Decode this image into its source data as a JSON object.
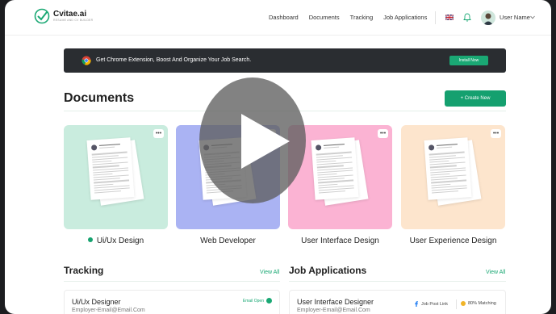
{
  "brand": {
    "name": "Cvitae.ai",
    "tagline": "RESUME AND CV BUILDER",
    "accent": "#1aa874"
  },
  "nav": {
    "items": [
      "Dashboard",
      "Documents",
      "Tracking",
      "Job Applications"
    ]
  },
  "user": {
    "name": "User Name"
  },
  "banner": {
    "text": "Get Chrome Extension, Boost And Organize Your Job Search.",
    "button": "Install Now"
  },
  "documents": {
    "title": "Documents",
    "create_button": "+ Create New",
    "menu_glyph": "•••",
    "cards": [
      {
        "label": "Ui/Ux Design",
        "bg": "#c9ecde",
        "active": true
      },
      {
        "label": "Web Developer",
        "bg": "#aab3f3",
        "active": false
      },
      {
        "label": "User Interface Design",
        "bg": "#fbb3d3",
        "active": false
      },
      {
        "label": "User Experience Design",
        "bg": "#fde5cd",
        "active": false
      }
    ]
  },
  "tracking": {
    "title": "Tracking",
    "view_all": "View All",
    "item": {
      "title": "Ui/Ux Designer",
      "email": "Employer-Email@Email.Com",
      "status": "Email Open"
    }
  },
  "job_applications": {
    "title": "Job Applications",
    "view_all": "View All",
    "item": {
      "title": "User Interface Designer",
      "email": "Employer-Email@Email.Com",
      "source": "Job Post Link",
      "match": "80% Matching"
    }
  }
}
